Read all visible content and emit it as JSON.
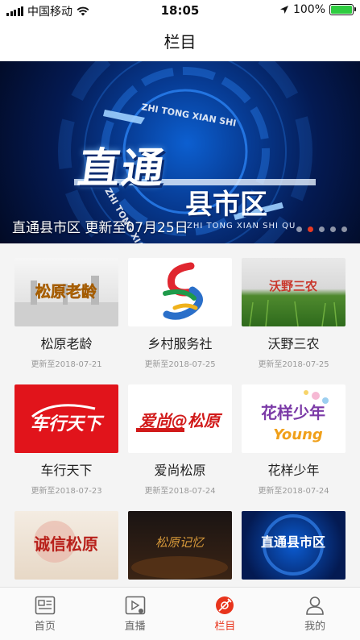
{
  "status_bar": {
    "carrier": "中国移动",
    "time": "18:05",
    "battery": "100%",
    "battery_level": 1.0
  },
  "nav": {
    "title": "栏目"
  },
  "banner": {
    "logo_main": "直通",
    "logo_sub": "县市区",
    "pinyin": "ZHI TONG XIAN SHI QU",
    "caption": "直通县市区 更新至07月25日",
    "slide_count": 5,
    "active_slide": 1
  },
  "programs": [
    {
      "title": "松原老龄",
      "date": "更新至2018-07-21",
      "thumb_text": "松原老龄"
    },
    {
      "title": "乡村服务社",
      "date": "更新至2018-07-25",
      "thumb_text": ""
    },
    {
      "title": "沃野三农",
      "date": "更新至2018-07-25",
      "thumb_text": "沃野三农"
    },
    {
      "title": "车行天下",
      "date": "更新至2018-07-23",
      "thumb_text": "车行天下"
    },
    {
      "title": "爱尚松原",
      "date": "更新至2018-07-24",
      "thumb_text": "爱尚@松原"
    },
    {
      "title": "花样少年",
      "date": "更新至2018-07-24",
      "thumb_text": "花样少年",
      "thumb_text2": "Young"
    },
    {
      "title": "",
      "date": "",
      "thumb_text": "诚信松原"
    },
    {
      "title": "",
      "date": "",
      "thumb_text": "松原记忆"
    },
    {
      "title": "",
      "date": "",
      "thumb_text": "直通县市区"
    }
  ],
  "tabs": [
    {
      "label": "首页",
      "icon": "news-icon",
      "active": false
    },
    {
      "label": "直播",
      "icon": "live-video-icon",
      "active": false
    },
    {
      "label": "栏目",
      "icon": "column-icon",
      "active": true
    },
    {
      "label": "我的",
      "icon": "user-icon",
      "active": false
    }
  ],
  "colors": {
    "accent": "#e8341c",
    "tab_inactive": "#666666",
    "date_gray": "#999999"
  }
}
